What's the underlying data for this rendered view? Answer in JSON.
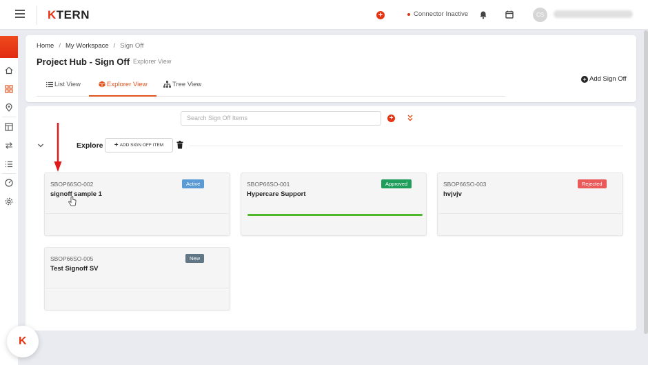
{
  "topbar": {
    "logo_k": "K",
    "logo_rest": "TERN",
    "connector_status": "Connector Inactive",
    "avatar_initials": "CS"
  },
  "breadcrumb": {
    "home": "Home",
    "workspace": "My Workspace",
    "current": "Sign Off"
  },
  "page": {
    "title": "Project Hub - Sign Off",
    "subtitle": "Explorer View"
  },
  "tabs": [
    {
      "label": "List View"
    },
    {
      "label": "Explorer View"
    },
    {
      "label": "Tree View"
    }
  ],
  "actions": {
    "add_signoff": "Add Sign Off",
    "search_placeholder": "Search Sign Off Items",
    "add_item": "ADD SIGN OFF ITEM"
  },
  "explore": {
    "label": "Explore"
  },
  "cards": [
    {
      "code": "SBOP66SO-002",
      "name": "signoff sample 1",
      "status": "Active",
      "status_color": "#5b9bd5"
    },
    {
      "code": "SBOP66SO-001",
      "name": "Hypercare Support",
      "status": "Approved",
      "status_color": "#1e9e5a",
      "progress": 1.0
    },
    {
      "code": "SBOP66SO-003",
      "name": "hvjvjv",
      "status": "Rejected",
      "status_color": "#ea5a5a"
    },
    {
      "code": "SBOP66SO-005",
      "name": "Test Signoff SV",
      "status": "New",
      "status_color": "#617785"
    }
  ],
  "colors": {
    "accent": "#e0531e",
    "brand_red": "#e63312"
  }
}
